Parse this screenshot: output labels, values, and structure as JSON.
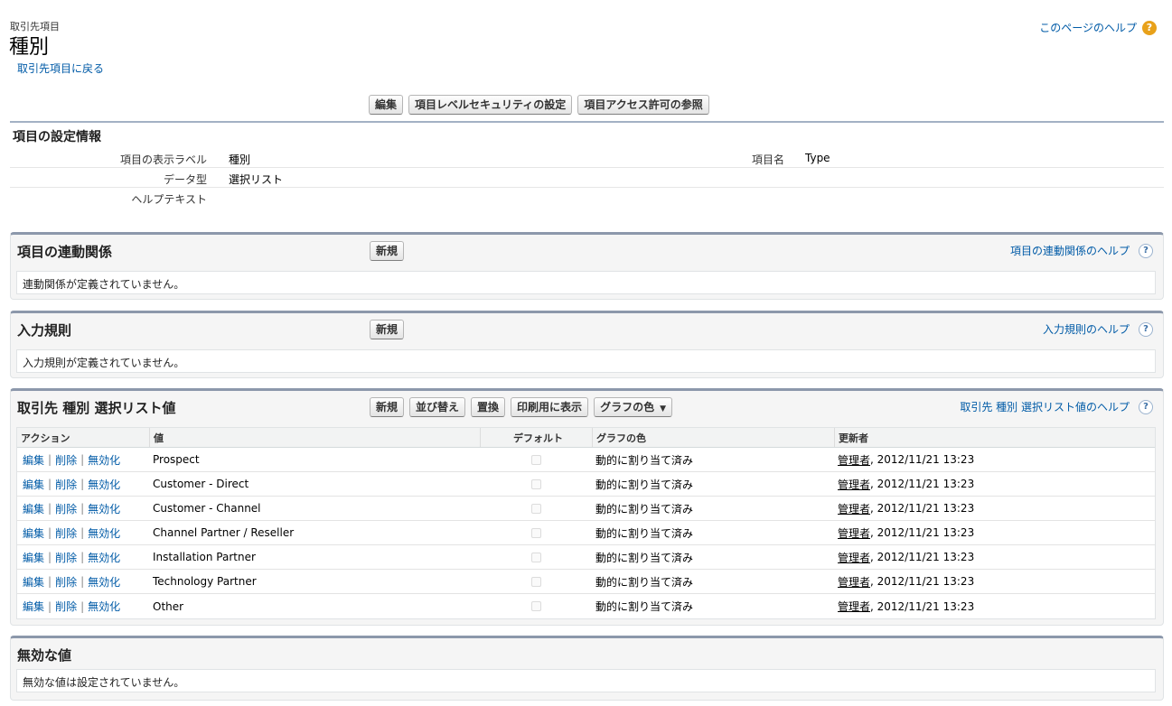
{
  "header": {
    "object_label": "取引先項目",
    "title": "種別",
    "back_link": "取引先項目に戻る",
    "help_link": "このページのヘルプ",
    "help_icon": "?"
  },
  "top_buttons": {
    "edit": "編集",
    "field_security": "項目レベルセキュリティの設定",
    "view_access": "項目アクセス許可の参照"
  },
  "detail": {
    "title": "項目の設定情報",
    "label_field_label": "項目の表示ラベル",
    "field_label_value": "種別",
    "data_type_label": "データ型",
    "data_type_value": "選択リスト",
    "help_text_label": "ヘルプテキスト",
    "help_text_value": "",
    "field_name_label": "項目名",
    "field_name_value": "Type"
  },
  "dependencies": {
    "title": "項目の連動関係",
    "new_button": "新規",
    "help_link": "項目の連動関係のヘルプ",
    "empty_message": "連動関係が定義されていません。"
  },
  "validation": {
    "title": "入力規則",
    "new_button": "新規",
    "help_link": "入力規則のヘルプ",
    "empty_message": "入力規則が定義されていません。"
  },
  "picklist": {
    "title": "取引先 種別 選択リスト値",
    "buttons": {
      "new": "新規",
      "reorder": "並び替え",
      "replace": "置換",
      "printable": "印刷用に表示",
      "chart_colors": "グラフの色"
    },
    "help_link": "取引先 種別 選択リスト値のヘルプ",
    "columns": {
      "action": "アクション",
      "value": "値",
      "default": "デフォルト",
      "chart_color": "グラフの色",
      "modified_by": "更新者"
    },
    "actions": {
      "edit": "編集",
      "delete": "削除",
      "deactivate": "無効化",
      "separator": "|"
    },
    "rows": [
      {
        "value": "Prospect",
        "color": "動的に割り当て済み",
        "user": "管理者",
        "date": ", 2012/11/21 13:23"
      },
      {
        "value": "Customer - Direct",
        "color": "動的に割り当て済み",
        "user": "管理者",
        "date": ", 2012/11/21 13:23"
      },
      {
        "value": "Customer - Channel",
        "color": "動的に割り当て済み",
        "user": "管理者",
        "date": ", 2012/11/21 13:23"
      },
      {
        "value": "Channel Partner / Reseller",
        "color": "動的に割り当て済み",
        "user": "管理者",
        "date": ", 2012/11/21 13:23"
      },
      {
        "value": "Installation Partner",
        "color": "動的に割り当て済み",
        "user": "管理者",
        "date": ", 2012/11/21 13:23"
      },
      {
        "value": "Technology Partner",
        "color": "動的に割り当て済み",
        "user": "管理者",
        "date": ", 2012/11/21 13:23"
      },
      {
        "value": "Other",
        "color": "動的に割り当て済み",
        "user": "管理者",
        "date": ", 2012/11/21 13:23"
      }
    ]
  },
  "inactive": {
    "title": "無効な値",
    "empty_message": "無効な値は設定されていません。"
  }
}
